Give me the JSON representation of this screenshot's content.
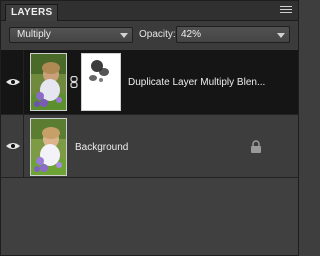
{
  "panel": {
    "tab_title": "LAYERS",
    "menu_icon": "panel-menu-icon"
  },
  "controls": {
    "blend_mode": "Multiply",
    "opacity_label": "Opacity:",
    "opacity_value": "42%"
  },
  "layers": [
    {
      "name": "Duplicate Layer Multiply Blen...",
      "visible": true,
      "selected": true,
      "has_mask": true,
      "linked": true
    },
    {
      "name": "Background",
      "visible": true,
      "selected": false,
      "locked": true
    }
  ]
}
